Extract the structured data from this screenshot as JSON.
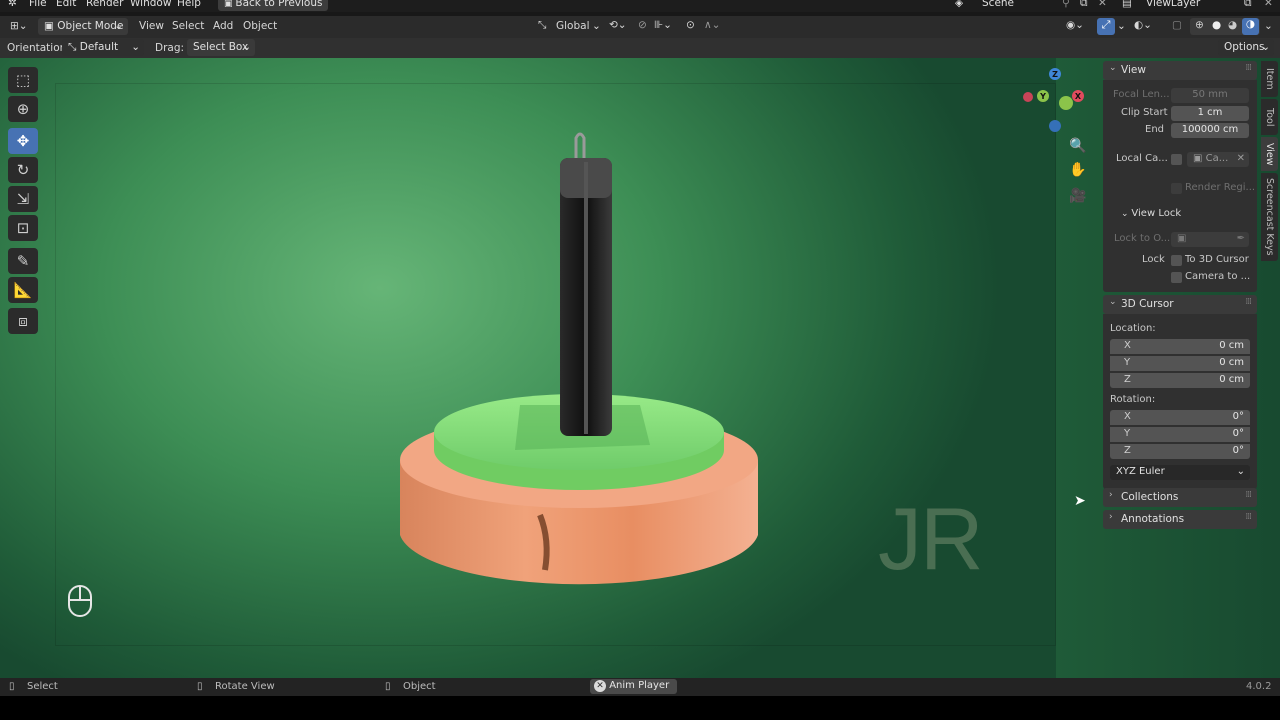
{
  "topbar": {
    "menus": [
      "File",
      "Edit",
      "Render",
      "Window",
      "Help"
    ],
    "back_button": "Back to Previous",
    "scene_name": "Scene",
    "view_layer": "ViewLayer"
  },
  "header": {
    "mode": "Object Mode",
    "menus": [
      "View",
      "Select",
      "Add",
      "Object"
    ],
    "transform_orientation": "Global",
    "options_label": "Options"
  },
  "tool_settings": {
    "orientation_label": "Orientation:",
    "orientation_value": "Default",
    "drag_label": "Drag:",
    "drag_value": "Select Box"
  },
  "gizmo": {
    "z_label": "Z",
    "y_label": "Y",
    "x_label": "X"
  },
  "watermark": "JR",
  "npanel": {
    "view": {
      "title": "View",
      "focal_length_label": "Focal Len...",
      "focal_length_value": "50 mm",
      "clip_start_label": "Clip Start",
      "clip_start_value": "1 cm",
      "clip_end_label": "End",
      "clip_end_value": "100000 cm",
      "local_camera_label": "Local Ca...",
      "local_camera_value": "Ca...",
      "render_region_label": "Render Regi..."
    },
    "view_lock": {
      "title": "View Lock",
      "lock_to_object_label": "Lock to O...",
      "lock_label": "Lock",
      "to_3d_cursor_label": "To 3D Cursor",
      "camera_to_view_label": "Camera to ..."
    },
    "cursor": {
      "title": "3D Cursor",
      "location_label": "Location:",
      "location": [
        {
          "axis": "X",
          "value": "0 cm"
        },
        {
          "axis": "Y",
          "value": "0 cm"
        },
        {
          "axis": "Z",
          "value": "0 cm"
        }
      ],
      "rotation_label": "Rotation:",
      "rotation": [
        {
          "axis": "X",
          "value": "0°"
        },
        {
          "axis": "Y",
          "value": "0°"
        },
        {
          "axis": "Z",
          "value": "0°"
        }
      ],
      "rotation_mode": "XYZ Euler"
    },
    "collections_title": "Collections",
    "annotations_title": "Annotations"
  },
  "side_tabs": [
    "Item",
    "Tool",
    "View",
    "Screencast Keys"
  ],
  "statusbar": {
    "select": "Select",
    "rotate_view": "Rotate View",
    "object": "Object",
    "anim_player": "Anim Player",
    "version": "4.0.2"
  },
  "colors": {
    "accent_blue": "#4772b3",
    "viewport_green": "#4a9e63",
    "platform_green": "#8fe07e",
    "platform_orange": "#e8906a",
    "gizmo_x": "#e04b5e",
    "gizmo_y": "#8bc34a",
    "gizmo_z": "#3f86d6"
  }
}
